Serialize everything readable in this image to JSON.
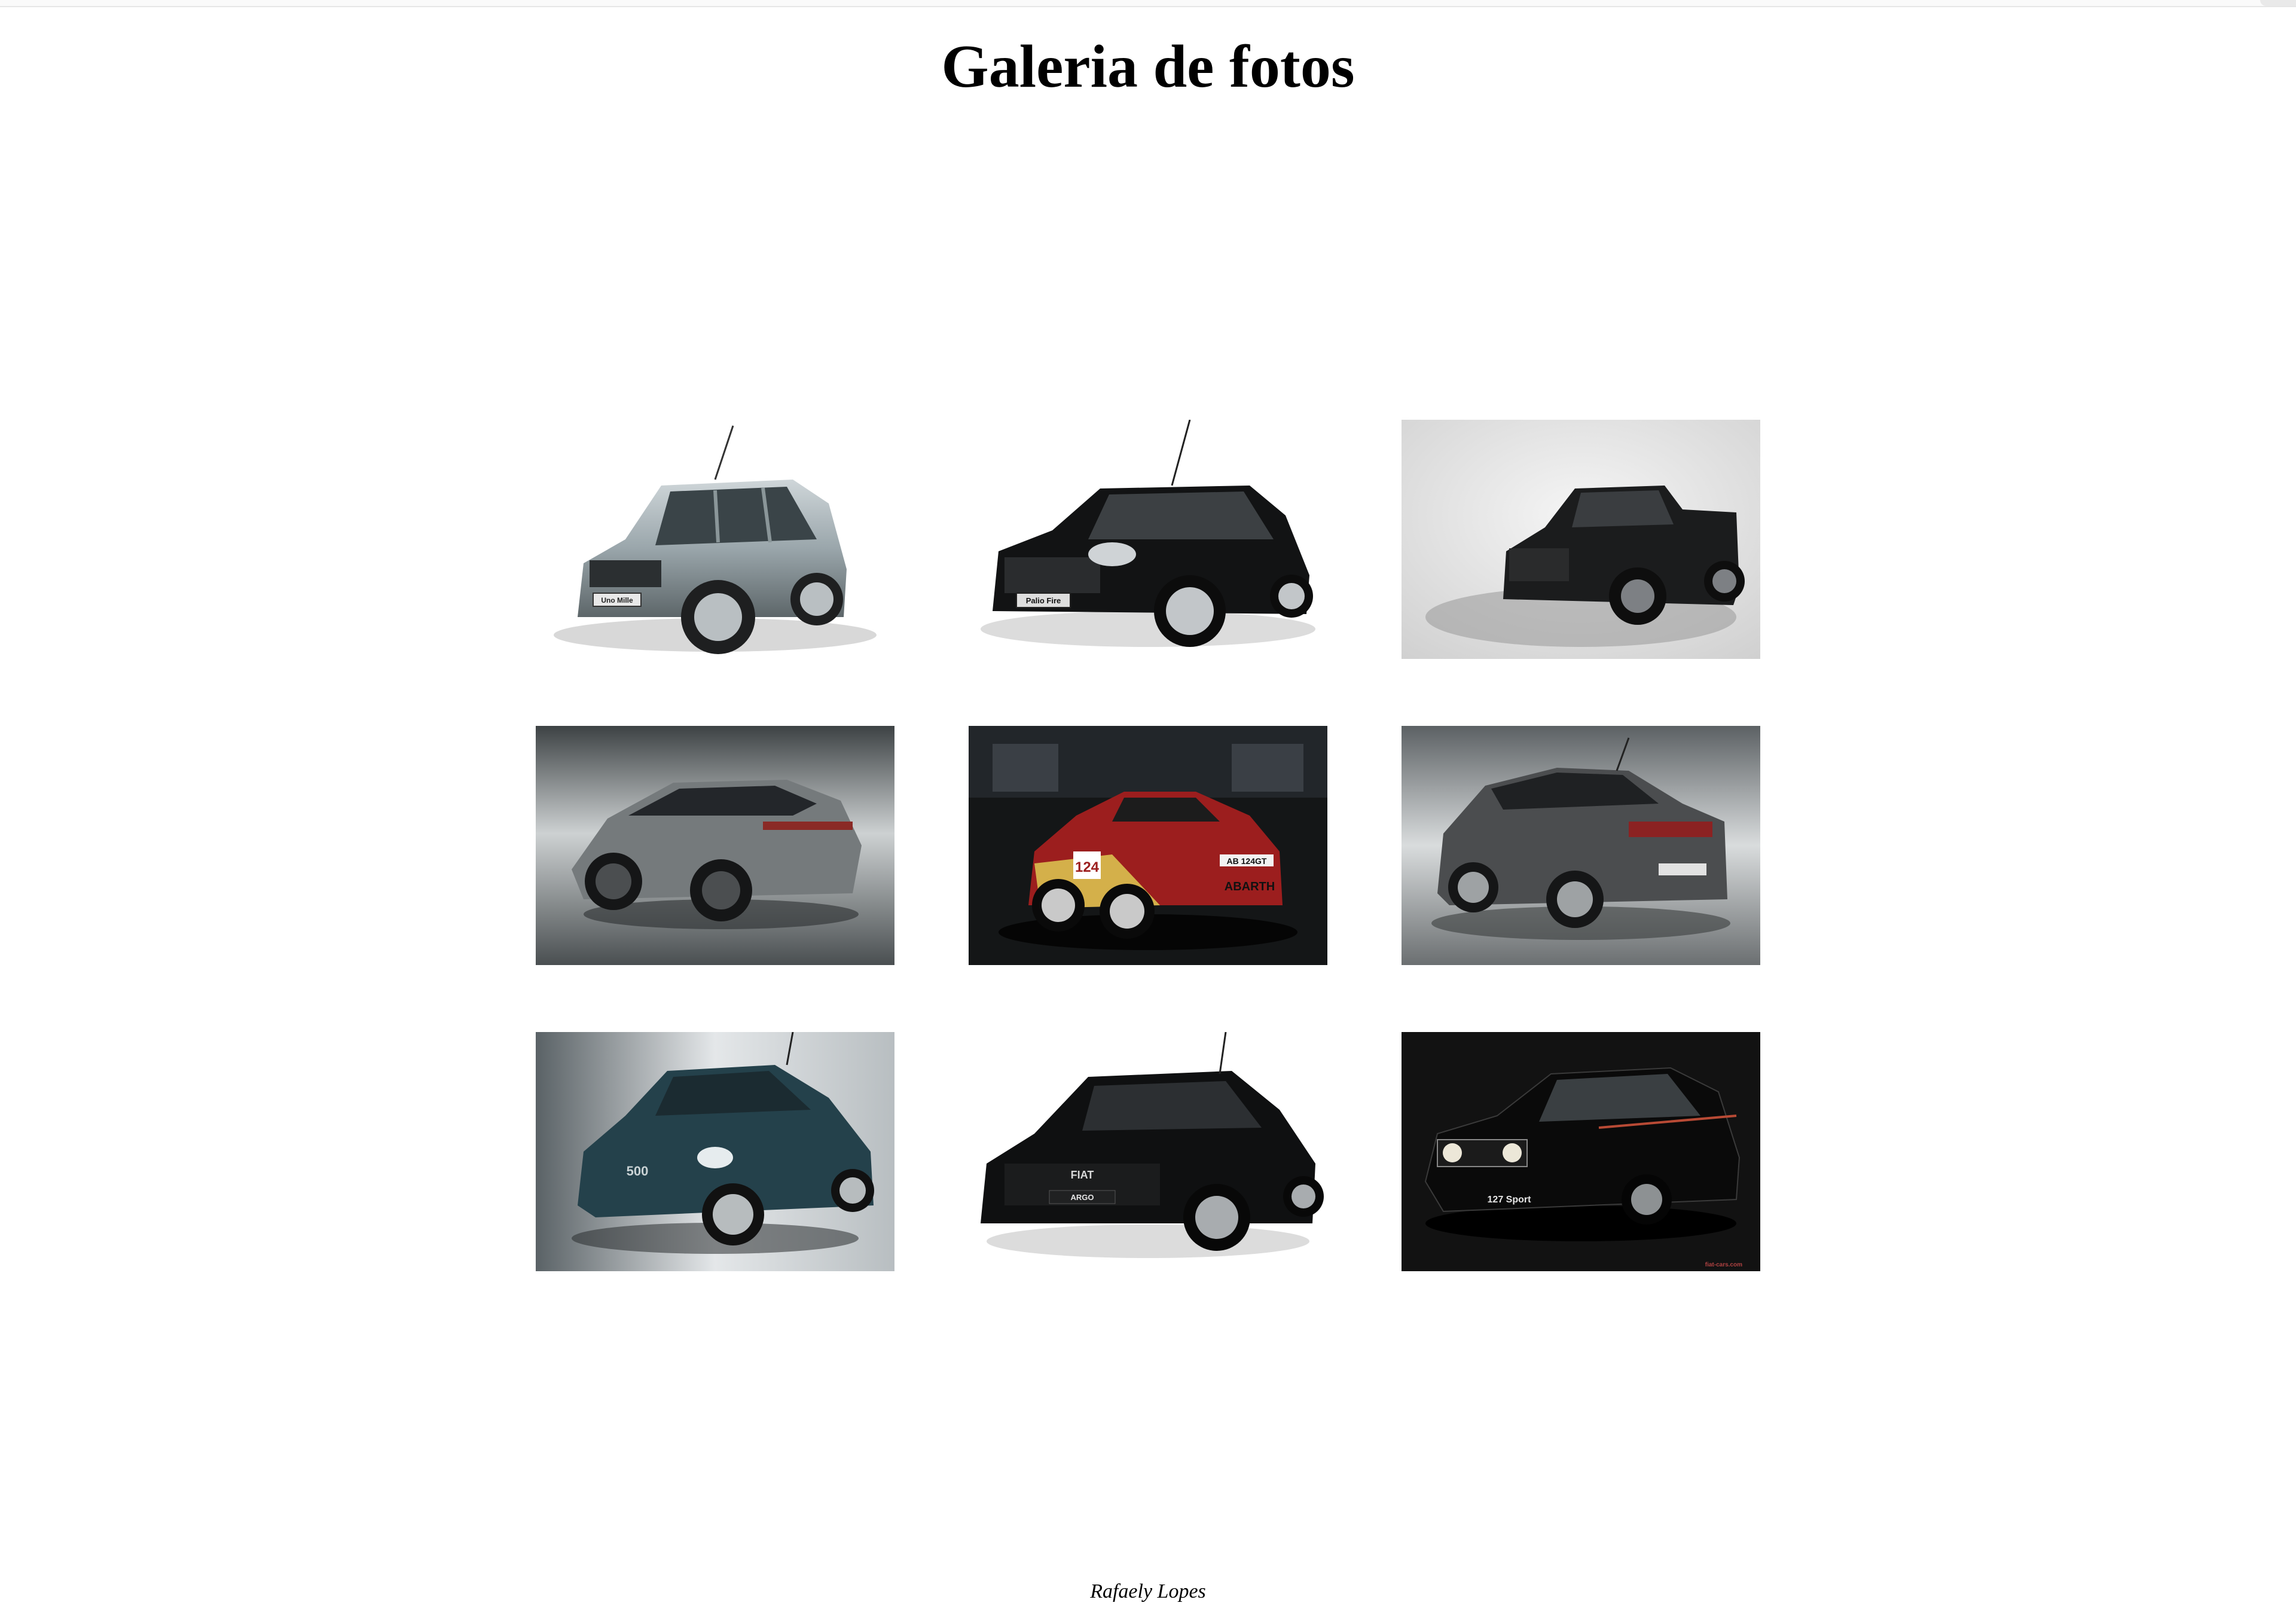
{
  "page": {
    "title": "Galeria de fotos",
    "footer": "Rafaely Lopes"
  },
  "gallery": {
    "photos": [
      {
        "subject": "silver hatchback on white background",
        "badge_text": "Uno Mille"
      },
      {
        "subject": "black hatchback on white background",
        "badge_text": "Palio Fire"
      },
      {
        "subject": "black pickup truck in grey studio"
      },
      {
        "subject": "grey coupe SUV in grey studio"
      },
      {
        "subject": "red and gold rally roadster in garage",
        "plate_text": "AB 124GT",
        "badge_text": "ABARTH",
        "number_text": "124"
      },
      {
        "subject": "dark grey sedan in grey studio"
      },
      {
        "subject": "teal electric city car in grey studio",
        "badge_text": "500"
      },
      {
        "subject": "black hatchback on white background",
        "badge_text": "FIAT",
        "plate_text": "ARGO"
      },
      {
        "subject": "black vintage hatchback on black background",
        "badge_text": "127 Sport",
        "watermark_text": "fiat-cars.com"
      }
    ]
  },
  "colors": {
    "background": "#ffffff",
    "title": "#000000",
    "footer": "#000000"
  }
}
